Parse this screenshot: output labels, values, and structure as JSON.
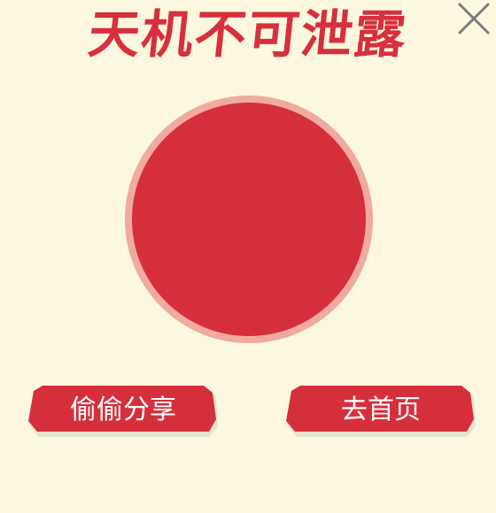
{
  "header": {
    "title": "天机不可泄露"
  },
  "close_icon": "close-icon",
  "actions": {
    "share_label": "偷偷分享",
    "home_label": "去首页"
  },
  "colors": {
    "background": "#fbf8df",
    "accent_red": "#d62f3c",
    "circle_ring": "#f0aaa0",
    "button_shadow": "#e6e3cf",
    "icon_gray": "#7b7b7b"
  }
}
